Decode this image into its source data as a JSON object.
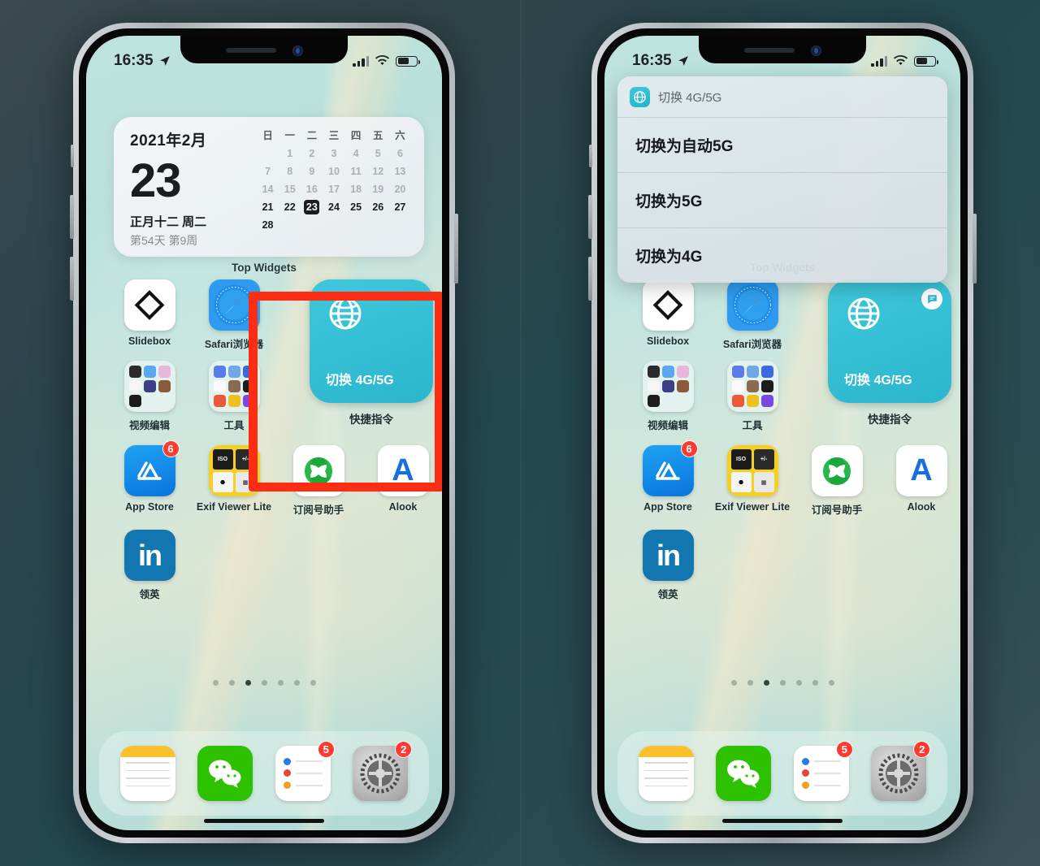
{
  "status_bar": {
    "time": "16:35",
    "location_icon": "location-arrow-icon",
    "signal_icon": "cellular-signal-icon",
    "wifi_icon": "wifi-icon",
    "battery_icon": "battery-icon"
  },
  "calendar_widget": {
    "year_month": "2021年2月",
    "day": "23",
    "lunar": "正月十二 周二",
    "meta": "第54天 第9周",
    "weekday_headers": [
      "日",
      "一",
      "二",
      "三",
      "四",
      "五",
      "六"
    ],
    "weeks": [
      [
        "",
        "1",
        "2",
        "3",
        "4",
        "5",
        "6"
      ],
      [
        "7",
        "8",
        "9",
        "10",
        "11",
        "12",
        "13"
      ],
      [
        "14",
        "15",
        "16",
        "17",
        "18",
        "19",
        "20"
      ],
      [
        "21",
        "22",
        "23",
        "24",
        "25",
        "26",
        "27"
      ],
      [
        "28",
        "",
        "",
        "",
        "",
        "",
        ""
      ]
    ],
    "today": "23",
    "widget_label": "Top Widgets"
  },
  "apps": {
    "row1": [
      {
        "label": "Slidebox",
        "icon": "slidebox-icon",
        "badge": ""
      },
      {
        "label": "Safari浏览器",
        "icon": "safari-icon",
        "badge": ""
      }
    ],
    "row2": [
      {
        "label": "视频编辑",
        "icon": "folder-icon",
        "badge": ""
      },
      {
        "label": "工具",
        "icon": "folder-icon",
        "badge": ""
      }
    ],
    "row3": [
      {
        "label": "App Store",
        "icon": "app-store-icon",
        "badge": "6"
      },
      {
        "label": "Exif Viewer Lite",
        "icon": "exif-viewer-icon",
        "badge": ""
      },
      {
        "label": "订阅号助手",
        "icon": "subscription-assistant-icon",
        "badge": ""
      },
      {
        "label": "Alook",
        "icon": "alook-icon",
        "badge": ""
      }
    ],
    "row4": [
      {
        "label": "领英",
        "icon": "linkedin-icon",
        "badge": ""
      }
    ]
  },
  "shortcut_widget": {
    "title": "切换 4G/5G",
    "label": "快捷指令",
    "icon": "globe-icon",
    "running_badge_icon": "shortcut-running-icon",
    "accent_color": "#2ebfd4"
  },
  "highlight": {
    "color": "#fc2d13"
  },
  "page_dots": {
    "count": 7,
    "active_index": 2
  },
  "dock": [
    {
      "label": "Notes",
      "icon": "notes-icon",
      "badge": ""
    },
    {
      "label": "WeChat",
      "icon": "wechat-icon",
      "badge": ""
    },
    {
      "label": "Reminders",
      "icon": "reminders-icon",
      "badge": "5"
    },
    {
      "label": "Settings",
      "icon": "settings-icon",
      "badge": "2"
    }
  ],
  "dialog": {
    "title": "切换 4G/5G",
    "icon": "globe-app-icon",
    "options": [
      "切换为自动5G",
      "切换为5G",
      "切换为4G"
    ]
  }
}
